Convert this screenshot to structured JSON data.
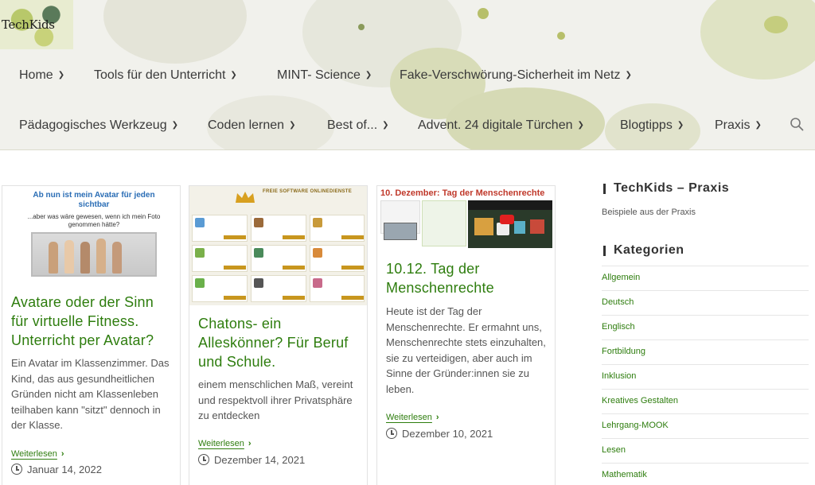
{
  "site": {
    "logo_text": "TechKids"
  },
  "nav": {
    "row1": [
      {
        "label": "Home"
      },
      {
        "label": "Tools für den Unterricht"
      },
      {
        "label": "MINT- Science"
      },
      {
        "label": "Fake-Verschwörung-Sicherheit im Netz"
      }
    ],
    "row2": [
      {
        "label": "Pädagogisches Werkzeug"
      },
      {
        "label": "Coden lernen"
      },
      {
        "label": "Best of..."
      },
      {
        "label": "Advent. 24 digitale Türchen"
      },
      {
        "label": "Blogtipps"
      },
      {
        "label": "Praxis"
      }
    ]
  },
  "posts": [
    {
      "thumb_heading": "Ab nun ist mein Avatar für jeden sichtbar",
      "thumb_sub": "...aber was wäre gewesen, wenn ich mein Foto genommen hätte?",
      "title": "Avatare oder der Sinn für virtuelle Fitness. Unterricht per Avatar?",
      "excerpt": "Ein Avatar im Klassenzimmer. Das Kind, das aus gesundheitlichen Gründen nicht am Klassenleben teilhaben kann \"sitzt\" dennoch in der Klasse.",
      "read_more": "Weiterlesen",
      "date": "Januar 14, 2022"
    },
    {
      "thumb_heading": "FREIE SOFTWARE ONLINEDIENSTE",
      "title": "Chatons- ein Alleskönner? Für Beruf und Schule.",
      "excerpt": "einem menschlichen Maß, vereint und respektvoll ihrer Privatsphäre zu entdecken",
      "read_more": "Weiterlesen",
      "date": "Dezember 14, 2021"
    },
    {
      "thumb_heading": "10. Dezember: Tag der Menschenrechte",
      "title": "10.12. Tag der Menschenrechte",
      "excerpt": "Heute ist der Tag der Menschenrechte. Er ermahnt uns, Menschenrechte stets einzuhalten, sie zu verteidigen, aber auch im Sinne der Gründer:innen sie zu leben.",
      "read_more": "Weiterlesen",
      "date": "Dezember 10, 2021"
    }
  ],
  "sidebar": {
    "praxis_title": "TechKids – Praxis",
    "praxis_sub": "Beispiele aus der Praxis",
    "categories_title": "Kategorien",
    "categories": [
      "Allgemein",
      "Deutsch",
      "Englisch",
      "Fortbildung",
      "Inklusion",
      "Kreatives Gestalten",
      "Lehrgang-MOOK",
      "Lesen",
      "Mathematik"
    ]
  },
  "colors": {
    "accent_green": "#2e7d0e",
    "thumb_red": "#c0392b",
    "thumb_blue": "#2a6db5",
    "gold": "#d8a020"
  },
  "icons": {
    "search": "search-icon",
    "clock": "clock-icon",
    "chevron": "chevron-down-icon"
  }
}
